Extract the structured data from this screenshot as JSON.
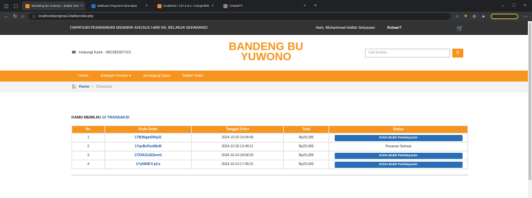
{
  "browser": {
    "tabs": [
      {
        "label": "Bandeng Bu Yuwono - Daftar Ord",
        "color": "#f7941d",
        "active": true
      },
      {
        "label": "Midtrans Payment Simulator",
        "color": "#2a6fb5",
        "active": false
      },
      {
        "label": "localhost / 127.0.0.1 / tokopekbb",
        "color": "#e68a3a",
        "active": false
      },
      {
        "label": "ChatGPT",
        "color": "#888888",
        "active": false
      }
    ],
    "url": "localhost/pengmas1/daftarorder.php"
  },
  "topbar": {
    "promo": "DAPATKAN PENAWARAN MENARIK KHUSUS HARI INI, BELANJA SEKARANG!",
    "greeting": "Halo, Muhammad Hafidz Setyawan",
    "logout": "Keluar?"
  },
  "header": {
    "phone": "Hubungi Kami : 081282357101",
    "brand_line1": "BANDENG BU",
    "brand_line2": "YUWONO",
    "search_placeholder": "Cari produk..."
  },
  "nav": {
    "items": [
      "Home",
      "Kategori Produk",
      "Keranjang Saya",
      "Daftar Order"
    ]
  },
  "breadcrumb": {
    "home": "Home",
    "separator": "/",
    "current": "Checkout"
  },
  "orders": {
    "summary_prefix": "KAMU MEMILIKI",
    "summary_count": "10 TRANSAKSI",
    "columns": [
      "No.",
      "Kode Order",
      "Tanggal Order",
      "Total",
      "Status"
    ],
    "rows": [
      {
        "no": "1",
        "code": "17B3NginDRq32",
        "date": "2024-10-20 19:34:45",
        "total": "Rp25,000",
        "status": "Kirim Bukti Pembayaran",
        "is_button": true
      },
      {
        "no": "2",
        "code": "17qvBvPaz68zM",
        "date": "2024-10-20 12:48:11",
        "total": "Rp25,000",
        "status": "Pesanan Selesai",
        "is_button": false
      },
      {
        "no": "3",
        "code": "17ZXKZo/ESmrG",
        "date": "2024-10-14 18:58:33",
        "total": "Rp25,000",
        "status": "Kirim Bukti Pembayaran",
        "is_button": true
      },
      {
        "no": "4",
        "code": "17yNiNfFV.pCo",
        "date": "2024-10-14 17:45:01",
        "total": "Rp25,000",
        "status": "Kirim Bukti Pembayaran",
        "is_button": true
      }
    ]
  },
  "colors": {
    "accent": "#f7941d",
    "link": "#1f5fa0",
    "button": "#2a6fb5",
    "topbar": "#333333"
  }
}
